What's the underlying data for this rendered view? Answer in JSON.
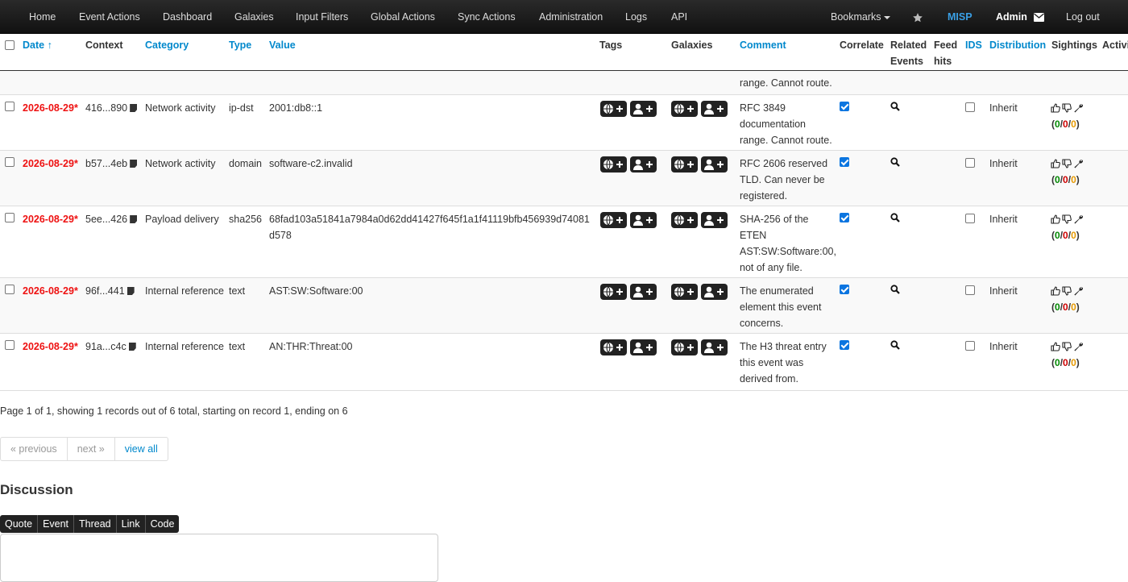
{
  "nav": {
    "items": [
      "Home",
      "Event Actions",
      "Dashboard",
      "Galaxies",
      "Input Filters",
      "Global Actions",
      "Sync Actions",
      "Administration",
      "Logs",
      "API"
    ],
    "bookmarks": "Bookmarks",
    "brand": "MISP",
    "user": "Admin",
    "logout": "Log out"
  },
  "table": {
    "headers": {
      "date": "Date",
      "context": "Context",
      "category": "Category",
      "type": "Type",
      "value": "Value",
      "tags": "Tags",
      "galaxies": "Galaxies",
      "comment": "Comment",
      "correlate": "Correlate",
      "related_events_1": "Related",
      "related_events_2": "Events",
      "feed_hits_1": "Feed",
      "feed_hits_2": "hits",
      "ids": "IDS",
      "distribution": "Distribution",
      "sightings": "Sightings",
      "activity": "Activi"
    },
    "sort_indicator": "↑",
    "partial_comment": "range. Cannot route.",
    "rows": [
      {
        "date": "2026-08-29*",
        "context": "416...890",
        "category": "Network activity",
        "type": "ip-dst",
        "value": "2001:db8::1",
        "comment_lines": [
          "RFC 3849",
          "documentation",
          "range. Cannot route."
        ],
        "correlate": true,
        "ids": false,
        "distribution": "Inherit",
        "counts": [
          "0",
          "0",
          "0"
        ]
      },
      {
        "date": "2026-08-29*",
        "context": "b57...4eb",
        "category": "Network activity",
        "type": "domain",
        "value": "software-c2.invalid",
        "comment_lines": [
          "RFC 2606 reserved",
          "TLD. Can never be",
          "registered."
        ],
        "correlate": true,
        "ids": false,
        "distribution": "Inherit",
        "counts": [
          "0",
          "0",
          "0"
        ]
      },
      {
        "date": "2026-08-29*",
        "context": "5ee...426",
        "category": "Payload delivery",
        "type": "sha256",
        "value": "68fad103a51841a7984a0d62dd41427f645f1a1f41119bfb456939d74081d578",
        "comment_lines": [
          "SHA-256 of the",
          "ETEN",
          "AST:SW:Software:00,",
          "not of any file."
        ],
        "correlate": true,
        "ids": false,
        "distribution": "Inherit",
        "counts": [
          "0",
          "0",
          "0"
        ]
      },
      {
        "date": "2026-08-29*",
        "context": "96f...441",
        "category": "Internal reference",
        "type": "text",
        "value": "AST:SW:Software:00",
        "comment_lines": [
          "The enumerated",
          "element this event",
          "concerns."
        ],
        "correlate": true,
        "ids": false,
        "distribution": "Inherit",
        "counts": [
          "0",
          "0",
          "0"
        ]
      },
      {
        "date": "2026-08-29*",
        "context": "91a...c4c",
        "category": "Internal reference",
        "type": "text",
        "value": "AN:THR:Threat:00",
        "comment_lines": [
          "The H3 threat entry",
          "this event was",
          "derived from."
        ],
        "correlate": true,
        "ids": false,
        "distribution": "Inherit",
        "counts": [
          "0",
          "0",
          "0"
        ]
      }
    ]
  },
  "pagination": {
    "info": "Page 1 of 1, showing 1 records out of 6 total, starting on record 1, ending on 6",
    "previous": "« previous",
    "next": "next »",
    "view_all": "view all"
  },
  "discussion": {
    "title": "Discussion",
    "toolbar": [
      "Quote",
      "Event",
      "Thread",
      "Link",
      "Code"
    ]
  },
  "colors": {
    "link": "#0088cc",
    "date_red": "#ee1111",
    "brand": "#3aa0e6"
  }
}
